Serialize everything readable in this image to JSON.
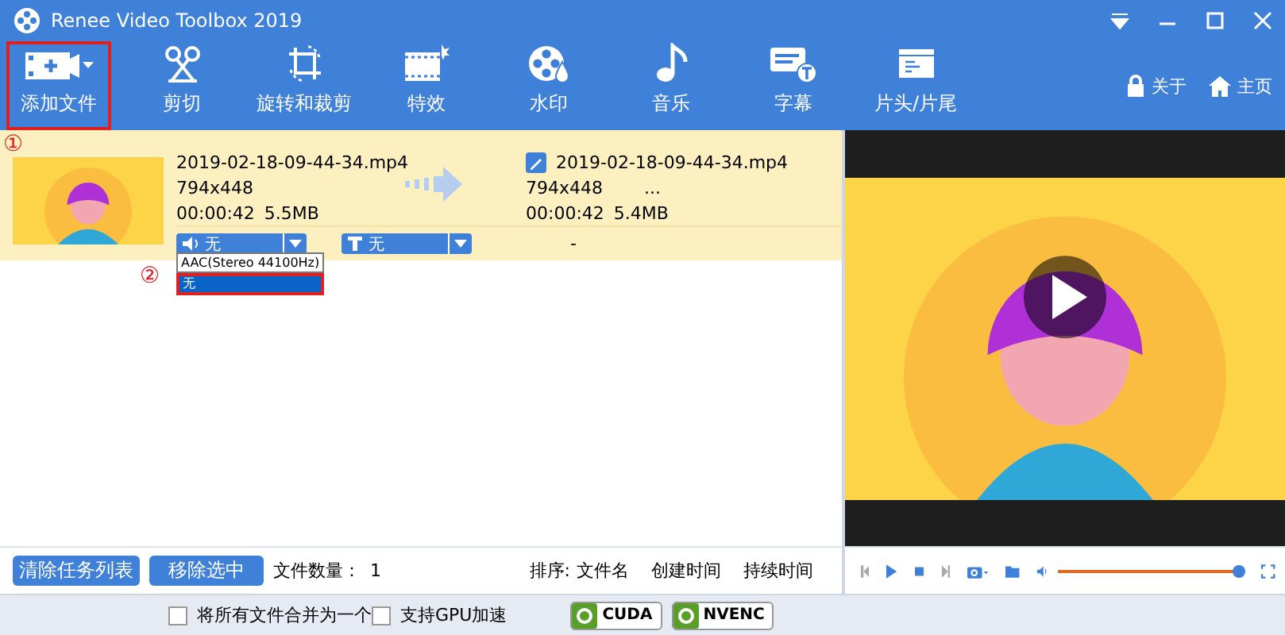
{
  "window": {
    "title": "Renee Video Toolbox 2019"
  },
  "toolbar": {
    "tools": [
      {
        "kind": "add",
        "label": "添加文件",
        "highlighted": true
      },
      {
        "kind": "cut",
        "label": "剪切",
        "highlighted": false
      },
      {
        "kind": "rotate",
        "label": "旋转和裁剪",
        "highlighted": false
      },
      {
        "kind": "effects",
        "label": "特效",
        "highlighted": false
      },
      {
        "kind": "watermark",
        "label": "水印",
        "highlighted": false
      },
      {
        "kind": "music",
        "label": "音乐",
        "highlighted": false
      },
      {
        "kind": "subtitle",
        "label": "字幕",
        "highlighted": false
      },
      {
        "kind": "intro",
        "label": "片头/片尾",
        "highlighted": false
      }
    ],
    "links": [
      {
        "kind": "about",
        "label": "关于"
      },
      {
        "kind": "home",
        "label": "主页"
      }
    ]
  },
  "files": [
    {
      "selected": true,
      "marker": "①",
      "source": {
        "name": "2019-02-18-09-44-34.mp4",
        "resolution": "794x448",
        "duration": "00:00:42",
        "size": "5.5MB"
      },
      "output": {
        "name": "2019-02-18-09-44-34.mp4",
        "resolution": "794x448",
        "extra": "...",
        "duration": "00:00:42",
        "size": "5.4MB"
      },
      "audio": {
        "value": "无",
        "expanded": true,
        "marker": "②",
        "options": [
          {
            "label": "AAC(Stereo 44100Hz)",
            "selected": false,
            "highlighted": false
          },
          {
            "label": "无",
            "selected": true,
            "highlighted": true
          }
        ]
      },
      "subtitle": {
        "value": "无"
      },
      "effect": "-"
    }
  ],
  "list_bar": {
    "buttons": [
      "清除任务列表",
      "移除选中"
    ],
    "count_label": "文件数量：",
    "count": "1",
    "sort_label": "排序:",
    "sort_options": [
      "文件名",
      "创建时间",
      "持续时间"
    ]
  },
  "player": {
    "volume": {
      "level": 0.97
    }
  },
  "options": [
    {
      "kind": "checkbox",
      "label": "将所有文件合并为一个",
      "checked": false
    },
    {
      "kind": "checkbox",
      "label": "支持GPU加速",
      "checked": false
    },
    {
      "kind": "badge",
      "label": "CUDA"
    },
    {
      "kind": "badge",
      "label": "NVENC"
    }
  ]
}
